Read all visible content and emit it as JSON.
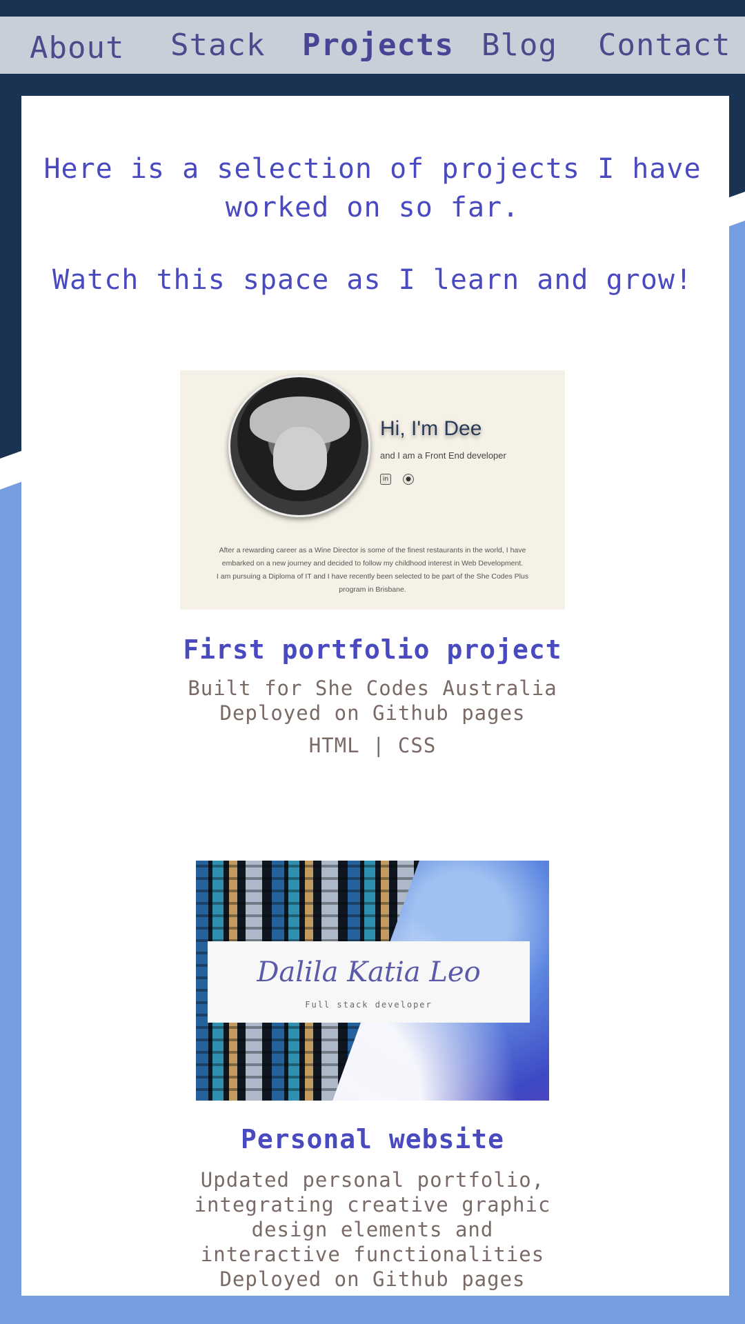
{
  "nav": {
    "items": [
      {
        "label": "About"
      },
      {
        "label": "Stack"
      },
      {
        "label": "Projects"
      },
      {
        "label": "Blog"
      },
      {
        "label": "Contact"
      }
    ],
    "active": "Projects"
  },
  "intro": {
    "line1": "Here is a selection of projects I have worked on so far.",
    "line2": "Watch this space as I learn and grow!"
  },
  "projects": [
    {
      "title": "First portfolio project",
      "description": "Built for She Codes Australia\nDeployed on Github pages",
      "tags": "HTML | CSS",
      "preview": {
        "heading": "Hi, I'm Dee",
        "subheading": "and I am a Front End developer",
        "icons": [
          "linkedin-icon",
          "github-icon"
        ],
        "bio": "After a rewarding career as a Wine Director is some of the finest restaurants in the world, I have embarked on a new journey and decided to follow my childhood interest in Web Development.\nI am pursuing a Diploma of IT and I have recently been selected to be part of the She Codes Plus program in Brisbane."
      }
    },
    {
      "title": "Personal website",
      "description": "Updated personal portfolio, integrating creative graphic design elements and interactive functionalities\nDeployed on Github pages",
      "preview": {
        "name": "Dalila Katia Leo",
        "role": "Full stack developer"
      }
    }
  ],
  "colors": {
    "dark_bg": "#1b3353",
    "light_bg": "#759de2",
    "accent": "#4a4ac0",
    "muted_text": "#7a6a66"
  }
}
